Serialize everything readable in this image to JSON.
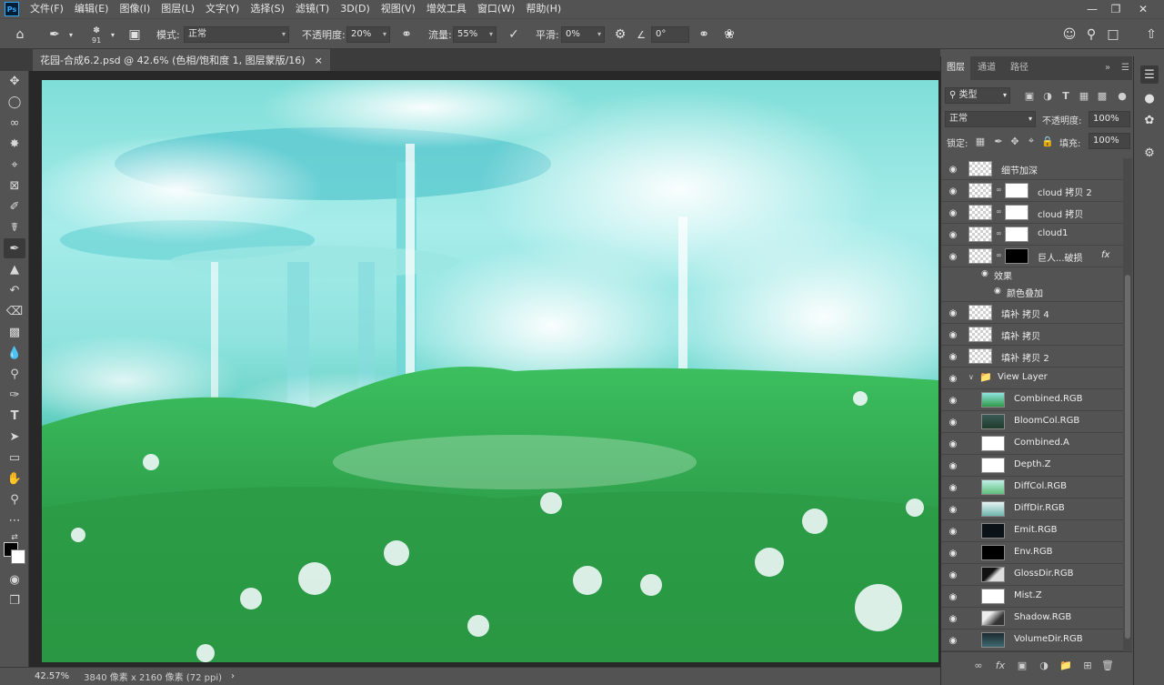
{
  "app": {
    "logo": "Ps"
  },
  "menu": [
    "文件(F)",
    "编辑(E)",
    "图像(I)",
    "图层(L)",
    "文字(Y)",
    "选择(S)",
    "滤镜(T)",
    "3D(D)",
    "视图(V)",
    "增效工具",
    "窗口(W)",
    "帮助(H)"
  ],
  "options": {
    "brush_size": "91",
    "mode_label": "模式:",
    "mode_value": "正常",
    "opacity_label": "不透明度:",
    "opacity_value": "20%",
    "flow_label": "流量:",
    "flow_value": "55%",
    "smooth_label": "平滑:",
    "smooth_value": "0%",
    "angle_value": "0°"
  },
  "document": {
    "tab_title": "花园-合成6.2.psd @ 42.6% (色相/饱和度 1, 图层蒙版/16)",
    "close_glyph": "×"
  },
  "status": {
    "zoom": "42.57%",
    "doc_info": "3840 像素 x 2160 像素 (72 ppi)",
    "arrow": "›"
  },
  "panel": {
    "tabs": [
      "图层",
      "通道",
      "路径"
    ],
    "collapse_glyph": "»",
    "filter_kind": "类型",
    "blend_mode": "正常",
    "opacity_label": "不透明度:",
    "opacity_value": "100%",
    "lock_label": "锁定:",
    "fill_label": "填充:",
    "fill_value": "100%",
    "layers": [
      {
        "name": "细节加深"
      },
      {
        "name": "cloud 拷贝 2"
      },
      {
        "name": "cloud 拷贝"
      },
      {
        "name": "cloud1"
      },
      {
        "name": "巨人...破损",
        "fx": "fx"
      },
      {
        "name": "效果"
      },
      {
        "name": "颜色叠加"
      },
      {
        "name": "填补 拷贝 4"
      },
      {
        "name": "填补 拷贝"
      },
      {
        "name": "填补 拷贝 2"
      },
      {
        "name": "View Layer"
      },
      {
        "name": "Combined.RGB"
      },
      {
        "name": "BloomCol.RGB"
      },
      {
        "name": "Combined.A"
      },
      {
        "name": "Depth.Z"
      },
      {
        "name": "DiffCol.RGB"
      },
      {
        "name": "DiffDir.RGB"
      },
      {
        "name": "Emit.RGB"
      },
      {
        "name": "Env.RGB"
      },
      {
        "name": "GlossDir.RGB"
      },
      {
        "name": "Mist.Z"
      },
      {
        "name": "Shadow.RGB"
      },
      {
        "name": "VolumeDir.RGB"
      }
    ]
  },
  "colors": {
    "ui": "#535353",
    "canvas_bg": "#282828",
    "sky": "#8fe3df",
    "grass": "#2a9a43"
  }
}
